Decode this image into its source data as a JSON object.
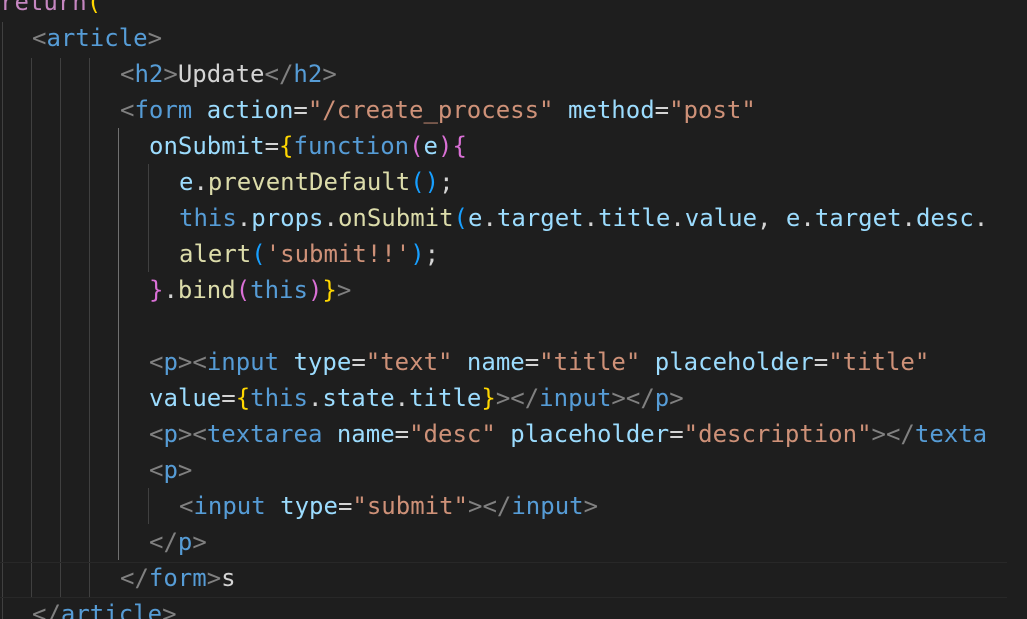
{
  "editor": {
    "theme": "dark",
    "background": "#1e1e1e",
    "colors": {
      "tag": "#569cd6",
      "punctuation": "#808080",
      "attribute": "#9cdcfe",
      "string": "#ce9178",
      "keyword": "#c586c0",
      "function": "#dcdcaa",
      "bracket_gold": "#ffd700",
      "bracket_orchid": "#da70d6",
      "bracket_blue": "#179fff",
      "text": "#d4d4d4"
    },
    "lines": [
      {
        "tokens": [
          {
            "t": "return",
            "c": "kw"
          },
          {
            "t": "(",
            "c": "b1"
          }
        ]
      },
      {
        "tokens": [
          {
            "t": "<",
            "c": "br"
          },
          {
            "t": "article",
            "c": "tag"
          },
          {
            "t": ">",
            "c": "br"
          }
        ]
      },
      {
        "tokens": [
          {
            "t": "<",
            "c": "br"
          },
          {
            "t": "h2",
            "c": "tag"
          },
          {
            "t": ">",
            "c": "br"
          },
          {
            "t": "Update",
            "c": "txt"
          },
          {
            "t": "</",
            "c": "br"
          },
          {
            "t": "h2",
            "c": "tag"
          },
          {
            "t": ">",
            "c": "br"
          }
        ]
      },
      {
        "tokens": [
          {
            "t": "<",
            "c": "br"
          },
          {
            "t": "form",
            "c": "tag"
          },
          {
            "t": " ",
            "c": "txt"
          },
          {
            "t": "action",
            "c": "attr"
          },
          {
            "t": "=",
            "c": "txt"
          },
          {
            "t": "\"/create_process\"",
            "c": "str"
          },
          {
            "t": " ",
            "c": "txt"
          },
          {
            "t": "method",
            "c": "attr"
          },
          {
            "t": "=",
            "c": "txt"
          },
          {
            "t": "\"post\"",
            "c": "str"
          }
        ]
      },
      {
        "tokens": [
          {
            "t": "onSubmit",
            "c": "attr"
          },
          {
            "t": "=",
            "c": "txt"
          },
          {
            "t": "{",
            "c": "b1"
          },
          {
            "t": "function",
            "c": "storage"
          },
          {
            "t": "(",
            "c": "b2"
          },
          {
            "t": "e",
            "c": "var"
          },
          {
            "t": ")",
            "c": "b2"
          },
          {
            "t": "{",
            "c": "b2"
          }
        ]
      },
      {
        "tokens": [
          {
            "t": "e",
            "c": "var"
          },
          {
            "t": ".",
            "c": "txt"
          },
          {
            "t": "preventDefault",
            "c": "fn"
          },
          {
            "t": "()",
            "c": "b3"
          },
          {
            "t": ";",
            "c": "txt"
          }
        ]
      },
      {
        "tokens": [
          {
            "t": "this",
            "c": "storage"
          },
          {
            "t": ".",
            "c": "txt"
          },
          {
            "t": "props",
            "c": "var"
          },
          {
            "t": ".",
            "c": "txt"
          },
          {
            "t": "onSubmit",
            "c": "fn"
          },
          {
            "t": "(",
            "c": "b3"
          },
          {
            "t": "e",
            "c": "var"
          },
          {
            "t": ".",
            "c": "txt"
          },
          {
            "t": "target",
            "c": "var"
          },
          {
            "t": ".",
            "c": "txt"
          },
          {
            "t": "title",
            "c": "var"
          },
          {
            "t": ".",
            "c": "txt"
          },
          {
            "t": "value",
            "c": "var"
          },
          {
            "t": ", ",
            "c": "txt"
          },
          {
            "t": "e",
            "c": "var"
          },
          {
            "t": ".",
            "c": "txt"
          },
          {
            "t": "target",
            "c": "var"
          },
          {
            "t": ".",
            "c": "txt"
          },
          {
            "t": "desc",
            "c": "var"
          },
          {
            "t": ".",
            "c": "txt"
          }
        ]
      },
      {
        "tokens": [
          {
            "t": "alert",
            "c": "fn"
          },
          {
            "t": "(",
            "c": "b3"
          },
          {
            "t": "'submit!!'",
            "c": "str"
          },
          {
            "t": ")",
            "c": "b3"
          },
          {
            "t": ";",
            "c": "txt"
          }
        ]
      },
      {
        "tokens": [
          {
            "t": "}",
            "c": "b2"
          },
          {
            "t": ".",
            "c": "txt"
          },
          {
            "t": "bind",
            "c": "fn"
          },
          {
            "t": "(",
            "c": "b2"
          },
          {
            "t": "this",
            "c": "storage"
          },
          {
            "t": ")",
            "c": "b2"
          },
          {
            "t": "}",
            "c": "b1"
          },
          {
            "t": ">",
            "c": "br"
          }
        ]
      },
      {
        "tokens": []
      },
      {
        "tokens": [
          {
            "t": "<",
            "c": "br"
          },
          {
            "t": "p",
            "c": "tag"
          },
          {
            "t": "><",
            "c": "br"
          },
          {
            "t": "input",
            "c": "tag"
          },
          {
            "t": " ",
            "c": "txt"
          },
          {
            "t": "type",
            "c": "attr"
          },
          {
            "t": "=",
            "c": "txt"
          },
          {
            "t": "\"text\"",
            "c": "str"
          },
          {
            "t": " ",
            "c": "txt"
          },
          {
            "t": "name",
            "c": "attr"
          },
          {
            "t": "=",
            "c": "txt"
          },
          {
            "t": "\"title\"",
            "c": "str"
          },
          {
            "t": " ",
            "c": "txt"
          },
          {
            "t": "placeholder",
            "c": "attr"
          },
          {
            "t": "=",
            "c": "txt"
          },
          {
            "t": "\"title\"",
            "c": "str"
          }
        ]
      },
      {
        "tokens": [
          {
            "t": "value",
            "c": "attr"
          },
          {
            "t": "=",
            "c": "txt"
          },
          {
            "t": "{",
            "c": "b1"
          },
          {
            "t": "this",
            "c": "storage"
          },
          {
            "t": ".",
            "c": "txt"
          },
          {
            "t": "state",
            "c": "var"
          },
          {
            "t": ".",
            "c": "txt"
          },
          {
            "t": "title",
            "c": "var"
          },
          {
            "t": "}",
            "c": "b1"
          },
          {
            "t": "></",
            "c": "br"
          },
          {
            "t": "input",
            "c": "tag"
          },
          {
            "t": "></",
            "c": "br"
          },
          {
            "t": "p",
            "c": "tag"
          },
          {
            "t": ">",
            "c": "br"
          }
        ]
      },
      {
        "tokens": [
          {
            "t": "<",
            "c": "br"
          },
          {
            "t": "p",
            "c": "tag"
          },
          {
            "t": "><",
            "c": "br"
          },
          {
            "t": "textarea",
            "c": "tag"
          },
          {
            "t": " ",
            "c": "txt"
          },
          {
            "t": "name",
            "c": "attr"
          },
          {
            "t": "=",
            "c": "txt"
          },
          {
            "t": "\"desc\"",
            "c": "str"
          },
          {
            "t": " ",
            "c": "txt"
          },
          {
            "t": "placeholder",
            "c": "attr"
          },
          {
            "t": "=",
            "c": "txt"
          },
          {
            "t": "\"description\"",
            "c": "str"
          },
          {
            "t": "></",
            "c": "br"
          },
          {
            "t": "texta",
            "c": "tag"
          }
        ]
      },
      {
        "tokens": [
          {
            "t": "<",
            "c": "br"
          },
          {
            "t": "p",
            "c": "tag"
          },
          {
            "t": ">",
            "c": "br"
          }
        ]
      },
      {
        "tokens": [
          {
            "t": "<",
            "c": "br"
          },
          {
            "t": "input",
            "c": "tag"
          },
          {
            "t": " ",
            "c": "txt"
          },
          {
            "t": "type",
            "c": "attr"
          },
          {
            "t": "=",
            "c": "txt"
          },
          {
            "t": "\"submit\"",
            "c": "str"
          },
          {
            "t": "></",
            "c": "br"
          },
          {
            "t": "input",
            "c": "tag"
          },
          {
            "t": ">",
            "c": "br"
          }
        ]
      },
      {
        "tokens": [
          {
            "t": "</",
            "c": "br"
          },
          {
            "t": "p",
            "c": "tag"
          },
          {
            "t": ">",
            "c": "br"
          }
        ]
      },
      {
        "tokens": [
          {
            "t": "</",
            "c": "br"
          },
          {
            "t": "form",
            "c": "tag"
          },
          {
            "t": ">",
            "c": "br"
          },
          {
            "t": "s",
            "c": "txt"
          }
        ]
      },
      {
        "tokens": [
          {
            "t": "</",
            "c": "br"
          },
          {
            "t": "article",
            "c": "tag"
          },
          {
            "t": ">",
            "c": "br"
          }
        ]
      }
    ]
  }
}
